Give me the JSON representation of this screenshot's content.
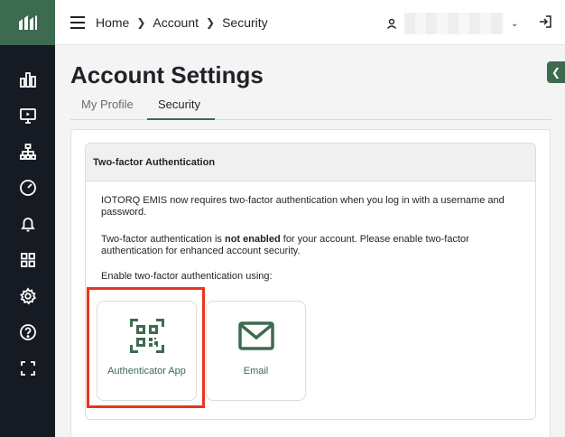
{
  "sidebar": {
    "items": [
      {
        "icon": "bar-chart-icon"
      },
      {
        "icon": "monitor-icon"
      },
      {
        "icon": "hierarchy-icon"
      },
      {
        "icon": "gauge-icon"
      },
      {
        "icon": "bell-icon"
      },
      {
        "icon": "grid-icon"
      },
      {
        "icon": "gear-icon"
      },
      {
        "icon": "help-icon"
      },
      {
        "icon": "fullscreen-icon"
      }
    ]
  },
  "header": {
    "breadcrumbs": [
      "Home",
      "Account",
      "Security"
    ]
  },
  "page": {
    "title": "Account Settings",
    "tabs": [
      {
        "label": "My Profile",
        "active": false
      },
      {
        "label": "Security",
        "active": true
      }
    ]
  },
  "tfa": {
    "heading": "Two-factor Authentication",
    "intro": "IOTORQ EMIS now requires two-factor authentication when you log in with a username and password.",
    "status_prefix": "Two-factor authentication is ",
    "status_bold": "not enabled",
    "status_suffix": " for your account. Please enable two-factor authentication for enhanced account security.",
    "prompt": "Enable two-factor authentication using:",
    "methods": [
      {
        "label": "Authenticator App",
        "icon": "qr-code-icon"
      },
      {
        "label": "Email",
        "icon": "envelope-icon"
      }
    ]
  },
  "colors": {
    "accent": "#3d6b4f",
    "sidebar": "#161a22",
    "highlight": "#e8351e"
  }
}
